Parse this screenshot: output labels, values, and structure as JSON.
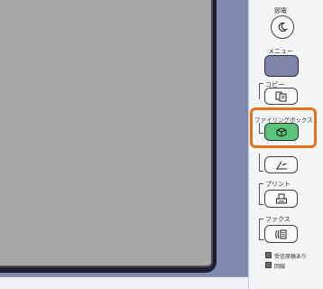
{
  "panel": {
    "power_save_label": "節電",
    "menu_label": "メニュー",
    "copy_label": "コピー",
    "filing_box_label": "ファイリングボックス",
    "print_label": "プリント",
    "fax_label": "ファクス",
    "indicator_received": "受信原稿あり",
    "indicator_line": "回線"
  },
  "colors": {
    "accent_highlight": "#e8721c",
    "filing_button": "#5cc47a",
    "menu_button": "#7d84a8"
  }
}
